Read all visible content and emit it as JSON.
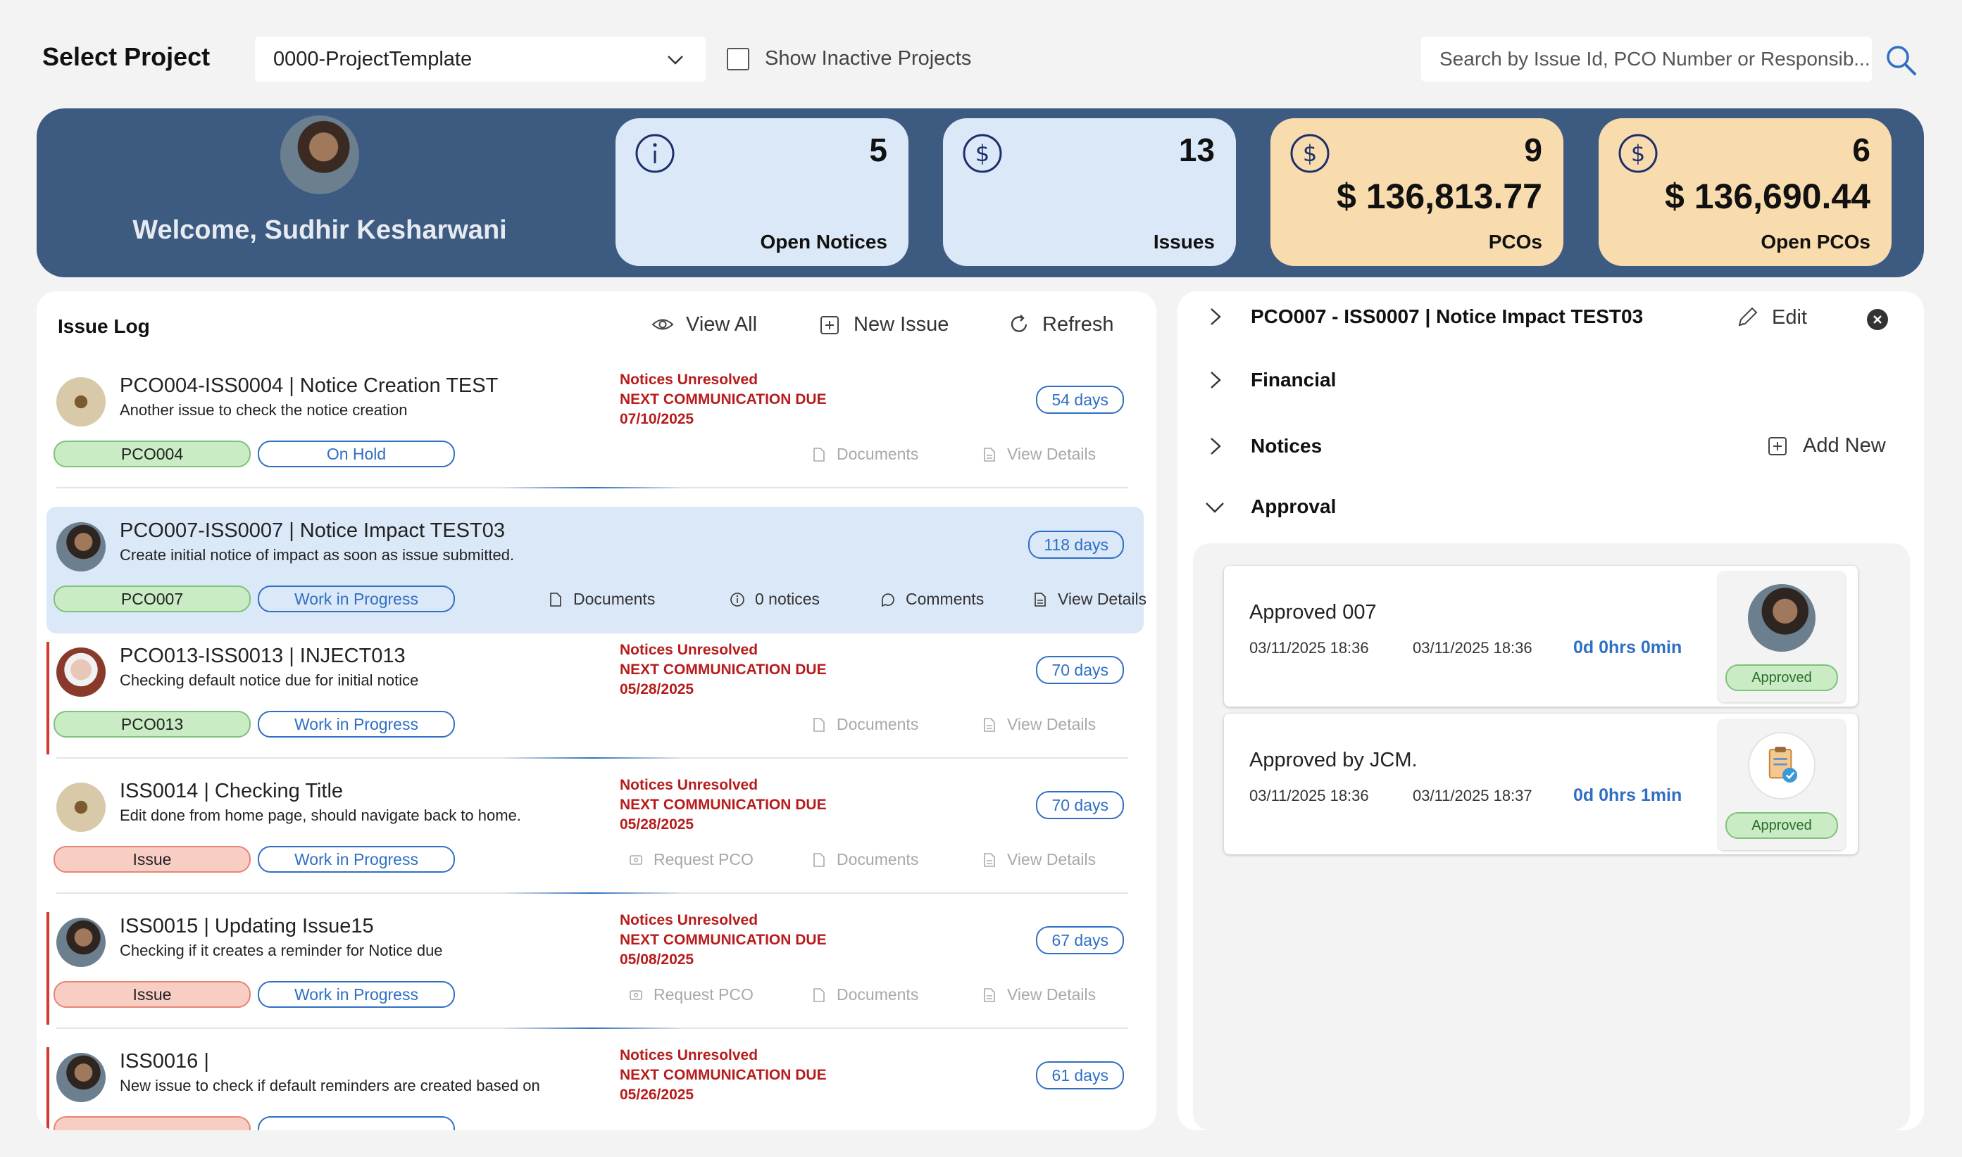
{
  "topbar": {
    "select_label": "Select Project",
    "project_value": "0000-ProjectTemplate",
    "inactive_label": "Show Inactive Projects",
    "search_placeholder": "Search by Issue Id, PCO Number or Responsib..."
  },
  "banner": {
    "welcome": "Welcome, Sudhir Kesharwani",
    "cards": [
      {
        "icon": "info-icon",
        "count": "5",
        "amount": "",
        "label": "Open Notices"
      },
      {
        "icon": "dollar-icon",
        "count": "13",
        "amount": "",
        "label": "Issues"
      },
      {
        "icon": "dollar-icon",
        "count": "9",
        "amount": "$ 136,813.77",
        "label": "PCOs"
      },
      {
        "icon": "dollar-icon",
        "count": "6",
        "amount": "$ 136,690.44",
        "label": "Open PCOs"
      }
    ]
  },
  "log": {
    "title": "Issue Log",
    "view_all": "View All",
    "new_issue": "New Issue",
    "refresh": "Refresh",
    "issues": [
      {
        "title": "PCO004-ISS0004 | Notice Creation TEST",
        "subtitle": "Another issue to check the notice creation",
        "warn1": "Notices Unresolved",
        "warn2": "NEXT COMMUNICATION DUE",
        "warn3": "07/10/2025",
        "days": "54 days",
        "tag": "PCO004",
        "status": "On Hold",
        "documents": "Documents",
        "view_details": "View Details"
      },
      {
        "title": "PCO007-ISS0007 | Notice Impact TEST03",
        "subtitle": "Create initial notice of impact as soon as issue submitted.",
        "days": "118 days",
        "tag": "PCO007",
        "status": "Work in Progress",
        "documents": "Documents",
        "notices": "0 notices",
        "comments": "Comments",
        "view_details": "View Details"
      },
      {
        "title": "PCO013-ISS0013 | INJECT013",
        "subtitle": "Checking default notice due for initial notice",
        "warn1": "Notices Unresolved",
        "warn2": "NEXT COMMUNICATION DUE",
        "warn3": "05/28/2025",
        "days": "70 days",
        "tag": "PCO013",
        "status": "Work in Progress",
        "documents": "Documents",
        "view_details": "View Details"
      },
      {
        "title": "ISS0014 | Checking Title",
        "subtitle": "Edit done from home page,  should navigate back to home.",
        "warn1": "Notices Unresolved",
        "warn2": "NEXT COMMUNICATION DUE",
        "warn3": "05/28/2025",
        "days": "70 days",
        "tag": "Issue",
        "status": "Work in Progress",
        "request_pco": "Request PCO",
        "documents": "Documents",
        "view_details": "View Details"
      },
      {
        "title": "ISS0015 | Updating Issue15",
        "subtitle": "Checking if it creates a reminder for Notice due",
        "warn1": "Notices Unresolved",
        "warn2": "NEXT COMMUNICATION DUE",
        "warn3": "05/08/2025",
        "days": "67 days",
        "tag": "Issue",
        "status": "Work in Progress",
        "request_pco": "Request PCO",
        "documents": "Documents",
        "view_details": "View Details"
      },
      {
        "title": "ISS0016 |",
        "subtitle": "New issue to check if default reminders are created based on",
        "warn1": "Notices Unresolved",
        "warn2": "NEXT COMMUNICATION DUE",
        "warn3": "05/26/2025",
        "days": "61 days"
      }
    ]
  },
  "detail": {
    "header": "PCO007 - ISS0007 | Notice Impact TEST03",
    "edit": "Edit",
    "financial": "Financial",
    "notices": "Notices",
    "add_new": "Add New",
    "approval": "Approval",
    "approvals": [
      {
        "name": "Approved 007",
        "date1": "03/11/2025 18:36",
        "date2": "03/11/2025 18:36",
        "duration": "0d 0hrs 0min",
        "status": "Approved"
      },
      {
        "name": "Approved by JCM.",
        "date1": "03/11/2025 18:36",
        "date2": "03/11/2025 18:37",
        "duration": "0d 0hrs 1min",
        "status": "Approved"
      }
    ]
  },
  "colors": {
    "banner": "#3d5a80",
    "accent": "#2f6fc4",
    "warn": "#b71c1c",
    "card_blue": "#dbe8f7",
    "card_tan": "#f8dcae"
  }
}
